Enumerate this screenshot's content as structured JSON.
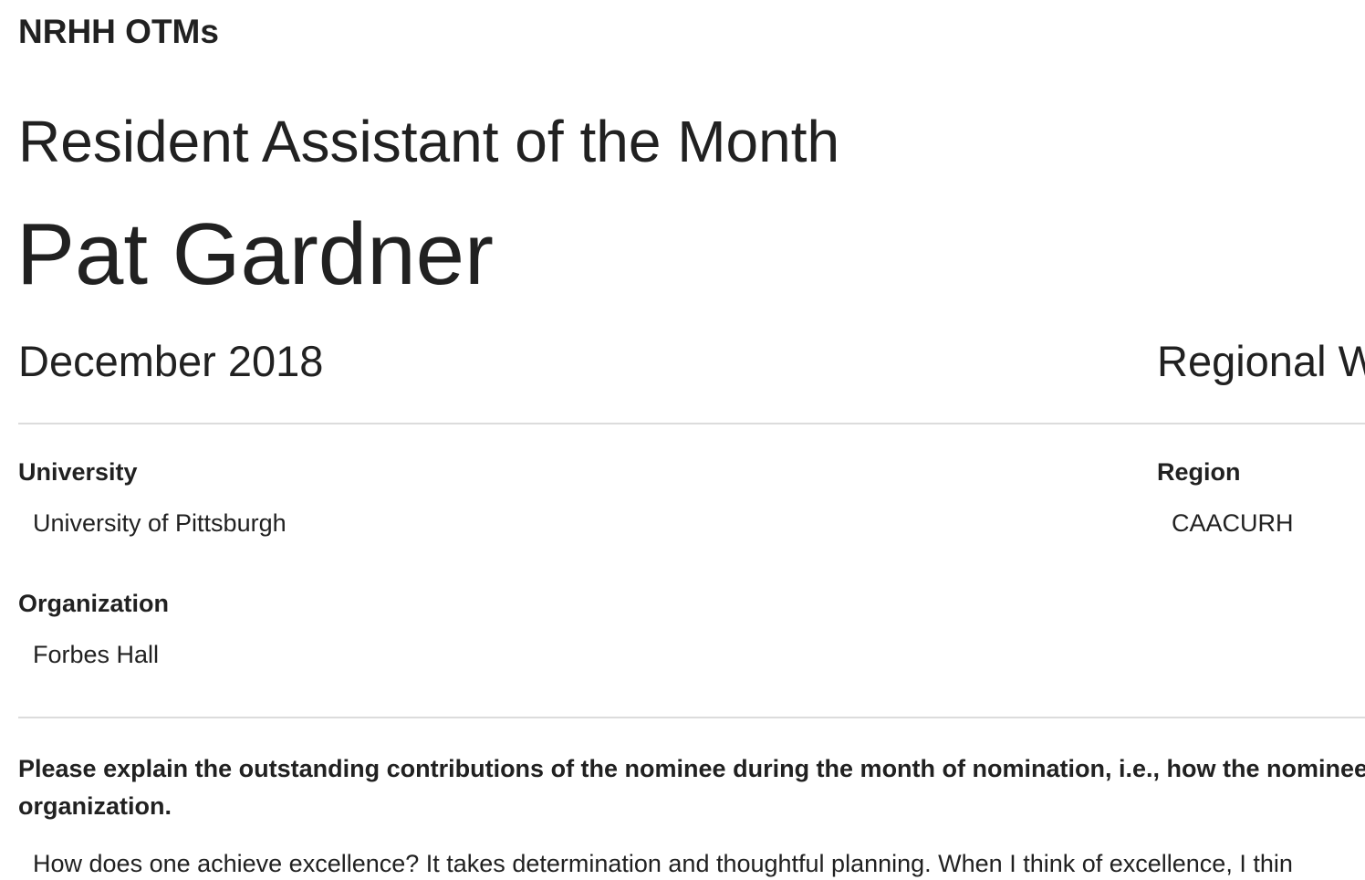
{
  "header": {
    "site_title": "NRHH OTMs"
  },
  "award": {
    "category": "Resident Assistant of the Month",
    "nominee_name": "Pat Gardner",
    "month": "December 2018",
    "regional_status": "Regional W"
  },
  "details": {
    "university_label": "University",
    "university_value": "University of Pittsburgh",
    "region_label": "Region",
    "region_value": "CAACURH",
    "organization_label": "Organization",
    "organization_value": "Forbes Hall"
  },
  "nomination": {
    "question": "Please explain the outstanding contributions of the nominee during the month of nomination, i.e., how the nominee organization.",
    "answer": "How does one achieve excellence? It takes determination and thoughtful planning. When I think of excellence, I thin"
  },
  "colors": {
    "text": "#212121",
    "divider": "#dcdcdc",
    "background": "#ffffff"
  }
}
